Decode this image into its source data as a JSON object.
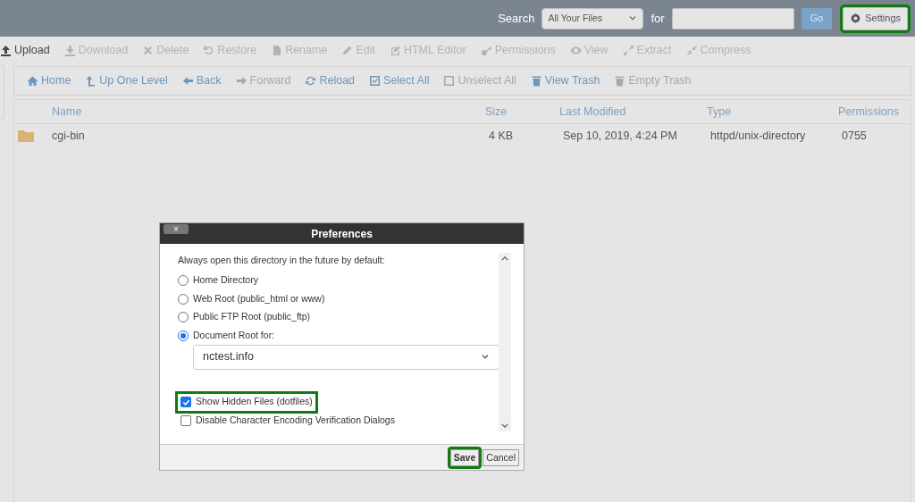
{
  "search": {
    "label": "Search",
    "scope": "All Your Files",
    "for_label": "for",
    "button": "Go"
  },
  "settings_button": {
    "label": "Settings",
    "highlighted": true
  },
  "toolbar": [
    {
      "label": "Upload",
      "disabled": false
    },
    {
      "label": "Download",
      "disabled": true
    },
    {
      "label": "Delete",
      "disabled": true
    },
    {
      "label": "Restore",
      "disabled": true
    },
    {
      "label": "Rename",
      "disabled": true
    },
    {
      "label": "Edit",
      "disabled": true
    },
    {
      "label": "HTML Editor",
      "disabled": true
    },
    {
      "label": "Permissions",
      "disabled": true
    },
    {
      "label": "View",
      "disabled": true
    },
    {
      "label": "Extract",
      "disabled": true
    },
    {
      "label": "Compress",
      "disabled": true
    }
  ],
  "nav": [
    {
      "label": "Home",
      "disabled": false
    },
    {
      "label": "Up One Level",
      "disabled": false
    },
    {
      "label": "Back",
      "disabled": false
    },
    {
      "label": "Forward",
      "disabled": true
    },
    {
      "label": "Reload",
      "disabled": false
    },
    {
      "label": "Select All",
      "disabled": false
    },
    {
      "label": "Unselect All",
      "disabled": true
    },
    {
      "label": "View Trash",
      "disabled": false
    },
    {
      "label": "Empty Trash",
      "disabled": true
    }
  ],
  "table": {
    "columns": [
      "Name",
      "Size",
      "Last Modified",
      "Type",
      "Permissions"
    ],
    "rows": [
      {
        "cells": [
          "cgi-bin",
          "4 KB",
          "Sep 10, 2019, 4:24 PM",
          "httpd/unix-directory",
          "0755"
        ]
      }
    ]
  },
  "dialog": {
    "title": "Preferences",
    "close": "×",
    "prompt": "Always open this directory in the future by default:",
    "options": [
      {
        "label": "Home Directory",
        "selected": false
      },
      {
        "label": "Web Root (public_html or www)",
        "selected": false
      },
      {
        "label": "Public FTP Root (public_ftp)",
        "selected": false
      },
      {
        "label": "Document Root for:",
        "selected": true
      }
    ],
    "domain": "nctest.info",
    "checkboxes": [
      {
        "label": "Show Hidden Files (dotfiles)",
        "checked": true,
        "highlighted": true
      },
      {
        "label": "Disable Character Encoding Verification Dialogs",
        "checked": false,
        "highlighted": false
      }
    ],
    "buttons": [
      {
        "label": "Save",
        "highlighted": true
      },
      {
        "label": "Cancel",
        "highlighted": false
      }
    ]
  }
}
